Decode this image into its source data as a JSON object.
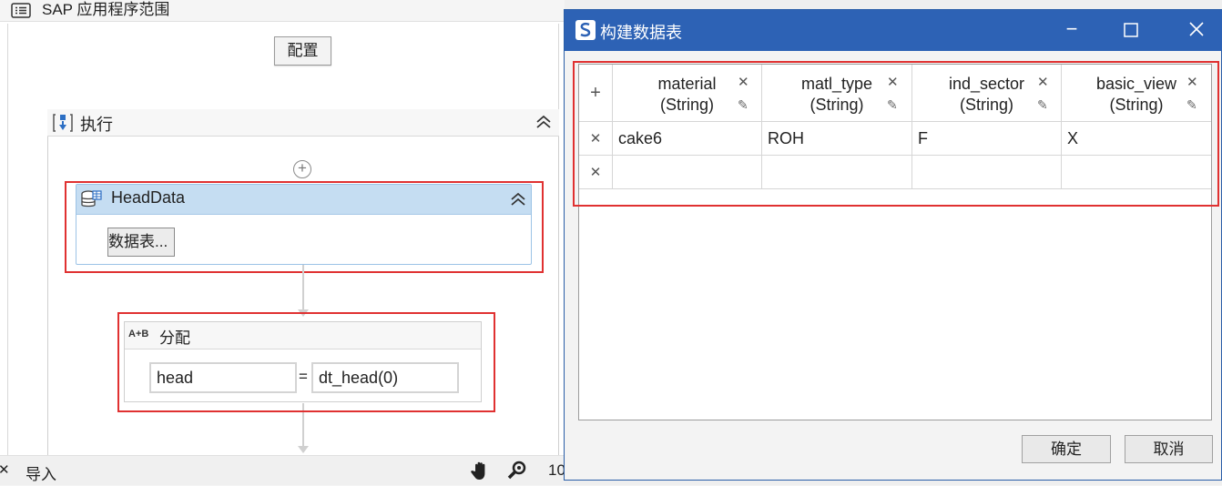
{
  "window": {
    "title": "SAP 应用程序范围"
  },
  "config_button": "配置",
  "sequence": {
    "title": "执行"
  },
  "head_data": {
    "title": "HeadData",
    "button": "数据表..."
  },
  "assign": {
    "title": "分配",
    "icon_text": "A+B",
    "left": "head",
    "equals": "=",
    "right": "dt_head(0)"
  },
  "status_bar": {
    "left_label": "导入",
    "zoom_partial": "10"
  },
  "dialog": {
    "title": "构建数据表",
    "columns": [
      {
        "name": "material",
        "type": "(String)"
      },
      {
        "name": "matl_type",
        "type": "(String)"
      },
      {
        "name": "ind_sector",
        "type": "(String)"
      },
      {
        "name": "basic_view",
        "type": "(String)"
      }
    ],
    "rows": [
      [
        "cake6",
        "ROH",
        "F",
        "X"
      ],
      [
        "",
        "",
        "",
        ""
      ]
    ],
    "ok": "确定",
    "cancel": "取消"
  },
  "colors": {
    "title_bar": "#2d62b5",
    "highlight": "#e03131",
    "activity_header": "#c5ddf2"
  }
}
